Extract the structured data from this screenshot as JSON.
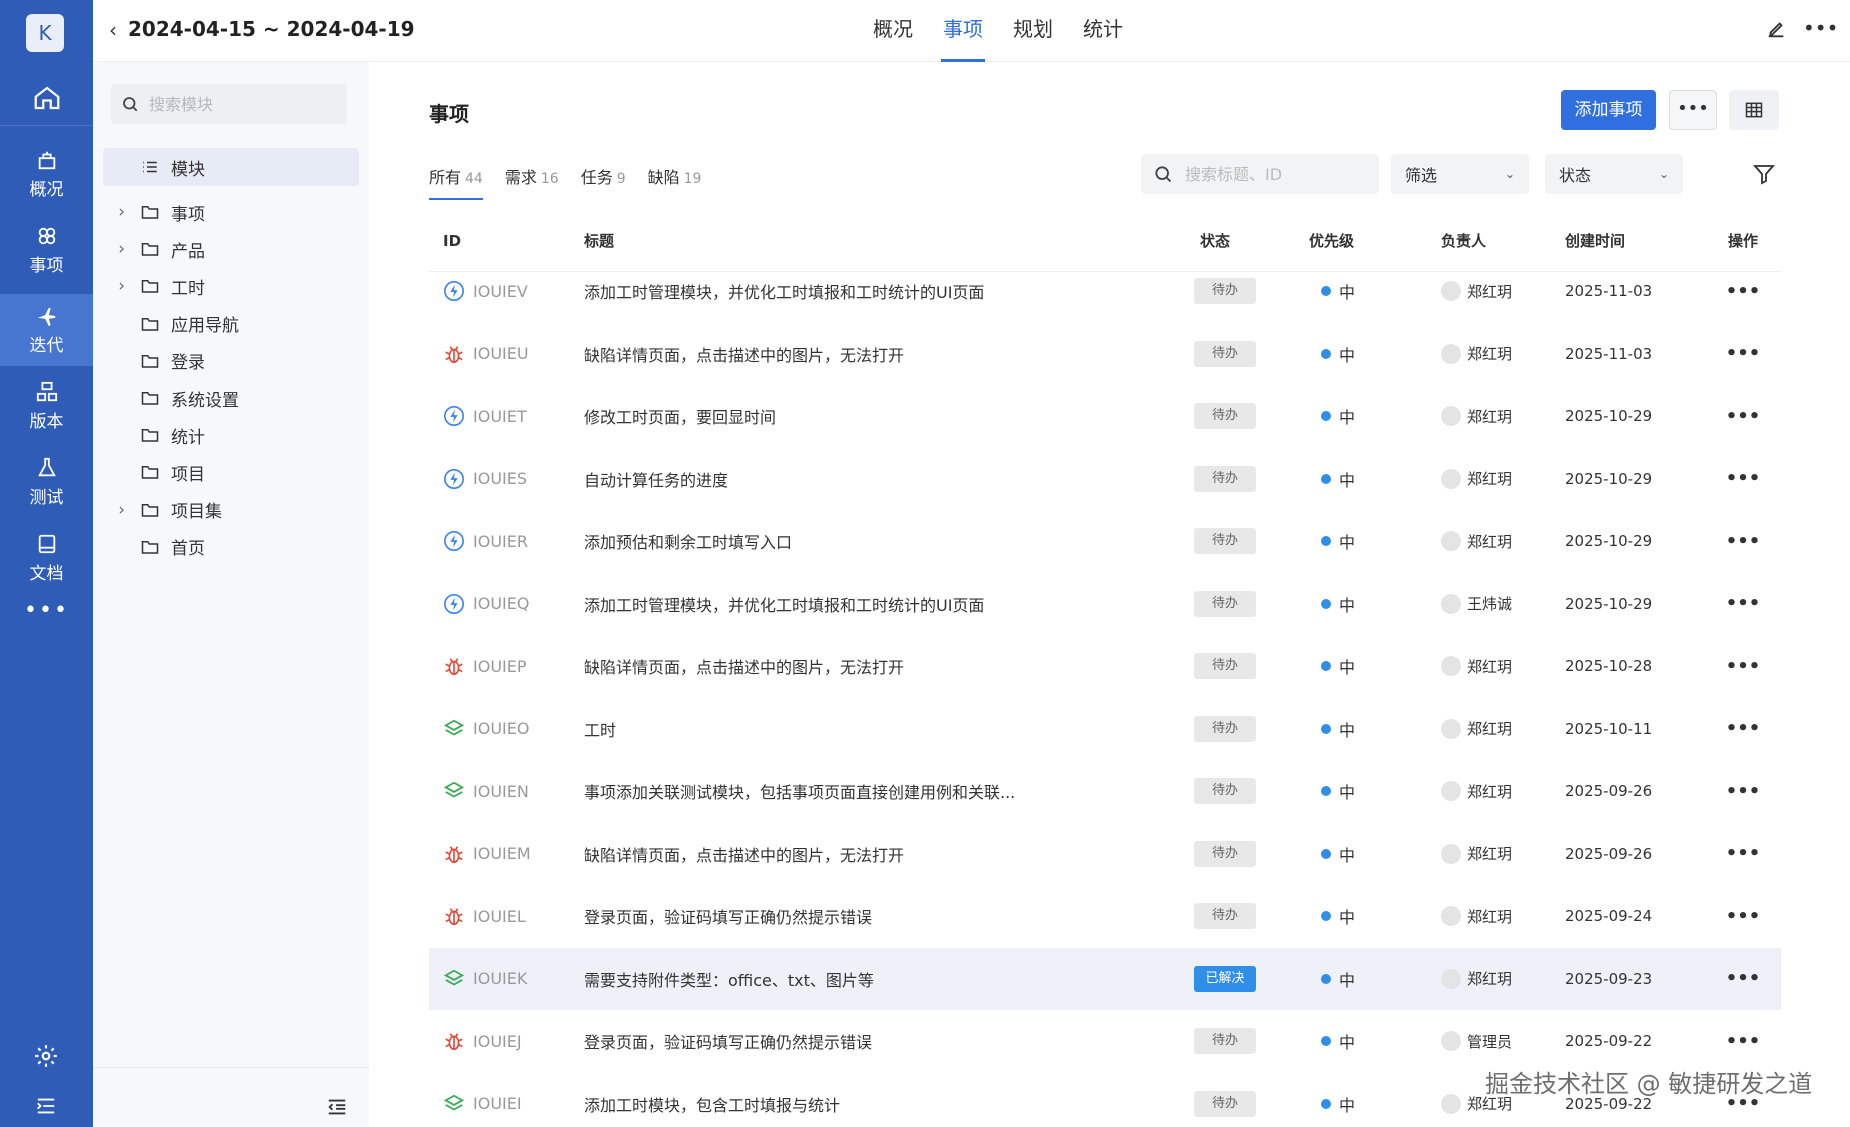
{
  "rail": {
    "logo": "K",
    "items": [
      {
        "label": "概况",
        "icon": "overview-icon"
      },
      {
        "label": "事项",
        "icon": "issues-icon"
      },
      {
        "label": "迭代",
        "icon": "iteration-icon",
        "active": true
      },
      {
        "label": "版本",
        "icon": "version-icon"
      },
      {
        "label": "测试",
        "icon": "test-icon"
      },
      {
        "label": "文档",
        "icon": "doc-icon"
      }
    ],
    "more": "•••"
  },
  "topbar": {
    "range": "2024-04-15 ~ 2024-04-19",
    "tabs": [
      "概况",
      "事项",
      "规划",
      "统计"
    ],
    "active_tab": "事项"
  },
  "panel": {
    "search_placeholder": "搜索模块",
    "root": "模块",
    "items": [
      {
        "label": "事项",
        "has_children": true
      },
      {
        "label": "产品",
        "has_children": true
      },
      {
        "label": "工时",
        "has_children": true
      },
      {
        "label": "应用导航",
        "has_children": false
      },
      {
        "label": "登录",
        "has_children": false
      },
      {
        "label": "系统设置",
        "has_children": false
      },
      {
        "label": "统计",
        "has_children": false
      },
      {
        "label": "项目",
        "has_children": false
      },
      {
        "label": "项目集",
        "has_children": true
      },
      {
        "label": "首页",
        "has_children": false
      }
    ]
  },
  "main": {
    "title": "事项",
    "add_button": "添加事项",
    "more_button": "•••",
    "subtabs": [
      {
        "label": "所有",
        "count": "44"
      },
      {
        "label": "需求",
        "count": "16"
      },
      {
        "label": "任务",
        "count": "9"
      },
      {
        "label": "缺陷",
        "count": "19"
      }
    ],
    "search_placeholder": "搜索标题、ID",
    "filter_label": "筛选",
    "status_label": "状态",
    "columns": [
      "ID",
      "标题",
      "状态",
      "优先级",
      "负责人",
      "创建时间",
      "操作"
    ],
    "rows": [
      {
        "type": "task",
        "id": "IOUIEV",
        "title": "添加工时管理模块，并优化工时填报和工时统计的UI页面",
        "status": "待办",
        "priority": "中",
        "owner": "郑红玥",
        "created": "2025-11-03"
      },
      {
        "type": "bug",
        "id": "IOUIEU",
        "title": "缺陷详情页面，点击描述中的图片，无法打开",
        "status": "待办",
        "priority": "中",
        "owner": "郑红玥",
        "created": "2025-11-03"
      },
      {
        "type": "task",
        "id": "IOUIET",
        "title": "修改工时页面，要回显时间",
        "status": "待办",
        "priority": "中",
        "owner": "郑红玥",
        "created": "2025-10-29"
      },
      {
        "type": "task",
        "id": "IOUIES",
        "title": "自动计算任务的进度",
        "status": "待办",
        "priority": "中",
        "owner": "郑红玥",
        "created": "2025-10-29"
      },
      {
        "type": "task",
        "id": "IOUIER",
        "title": "添加预估和剩余工时填写入口",
        "status": "待办",
        "priority": "中",
        "owner": "郑红玥",
        "created": "2025-10-29"
      },
      {
        "type": "task",
        "id": "IOUIEQ",
        "title": "添加工时管理模块，并优化工时填报和工时统计的UI页面",
        "status": "待办",
        "priority": "中",
        "owner": "王炜诚",
        "created": "2025-10-29"
      },
      {
        "type": "bug",
        "id": "IOUIEP",
        "title": "缺陷详情页面，点击描述中的图片，无法打开",
        "status": "待办",
        "priority": "中",
        "owner": "郑红玥",
        "created": "2025-10-28"
      },
      {
        "type": "story",
        "id": "IOUIEO",
        "title": "工时",
        "status": "待办",
        "priority": "中",
        "owner": "郑红玥",
        "created": "2025-10-11"
      },
      {
        "type": "story",
        "id": "IOUIEN",
        "title": "事项添加关联测试模块，包括事项页面直接创建用例和关联...",
        "status": "待办",
        "priority": "中",
        "owner": "郑红玥",
        "created": "2025-09-26"
      },
      {
        "type": "bug",
        "id": "IOUIEM",
        "title": "缺陷详情页面，点击描述中的图片，无法打开",
        "status": "待办",
        "priority": "中",
        "owner": "郑红玥",
        "created": "2025-09-26"
      },
      {
        "type": "bug",
        "id": "IOUIEL",
        "title": "登录页面，验证码填写正确仍然提示错误",
        "status": "待办",
        "priority": "中",
        "owner": "郑红玥",
        "created": "2025-09-24"
      },
      {
        "type": "story",
        "id": "IOUIEK",
        "title": "需要支持附件类型：office、txt、图片等",
        "status": "已解决",
        "priority": "中",
        "owner": "郑红玥",
        "created": "2025-09-23",
        "highlight": true
      },
      {
        "type": "bug",
        "id": "IOUIEJ",
        "title": "登录页面，验证码填写正确仍然提示错误",
        "status": "待办",
        "priority": "中",
        "owner": "管理员",
        "created": "2025-09-22"
      },
      {
        "type": "story",
        "id": "IOUIEI",
        "title": "添加工时模块，包含工时填报与统计",
        "status": "待办",
        "priority": "中",
        "owner": "郑红玥",
        "created": "2025-09-22"
      }
    ],
    "row_op": "•••"
  },
  "watermark": "掘金技术社区 @ 敏捷研发之道",
  "colors": {
    "rail": "#2f5cb6",
    "accent": "#2f6fe0",
    "task": "#3d86e8",
    "bug": "#e04a3a",
    "story": "#3dab5a"
  }
}
